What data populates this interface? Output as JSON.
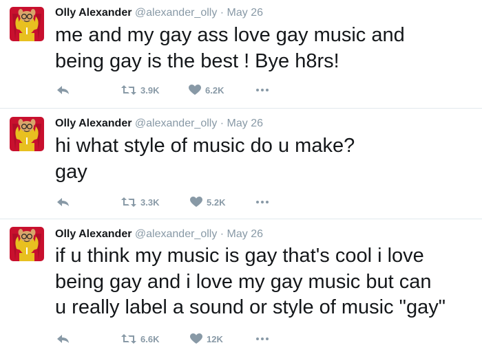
{
  "tweets": [
    {
      "name": "Olly Alexander",
      "handle": "@alexander_olly",
      "date": "· May 26",
      "lines": [
        "me and my gay ass love gay music and",
        "being gay is the best ! Bye h8rs!"
      ],
      "retweets": "3.9K",
      "likes": "6.2K"
    },
    {
      "name": "Olly Alexander",
      "handle": "@alexander_olly",
      "date": "· May 26",
      "lines": [
        "hi what style of music do u make?",
        "gay"
      ],
      "retweets": "3.3K",
      "likes": "5.2K"
    },
    {
      "name": "Olly Alexander",
      "handle": "@alexander_olly",
      "date": "· May 26",
      "lines": [
        "if u think my music is gay that's cool i love",
        "being gay and i love my gay music but can",
        "u really label a sound or style of music \"gay\""
      ],
      "retweets": "6.6K",
      "likes": "12K"
    }
  ],
  "icons": {
    "reply": "reply-icon",
    "retweet": "retweet-icon",
    "like": "heart-icon",
    "more": "more-dots-icon",
    "avatar": "arthur-aardvark-avatar"
  },
  "colors": {
    "text": "#14171a",
    "meta": "#8899a6",
    "divider": "#e1e8ed",
    "avatar_bg": "#c8102e"
  }
}
